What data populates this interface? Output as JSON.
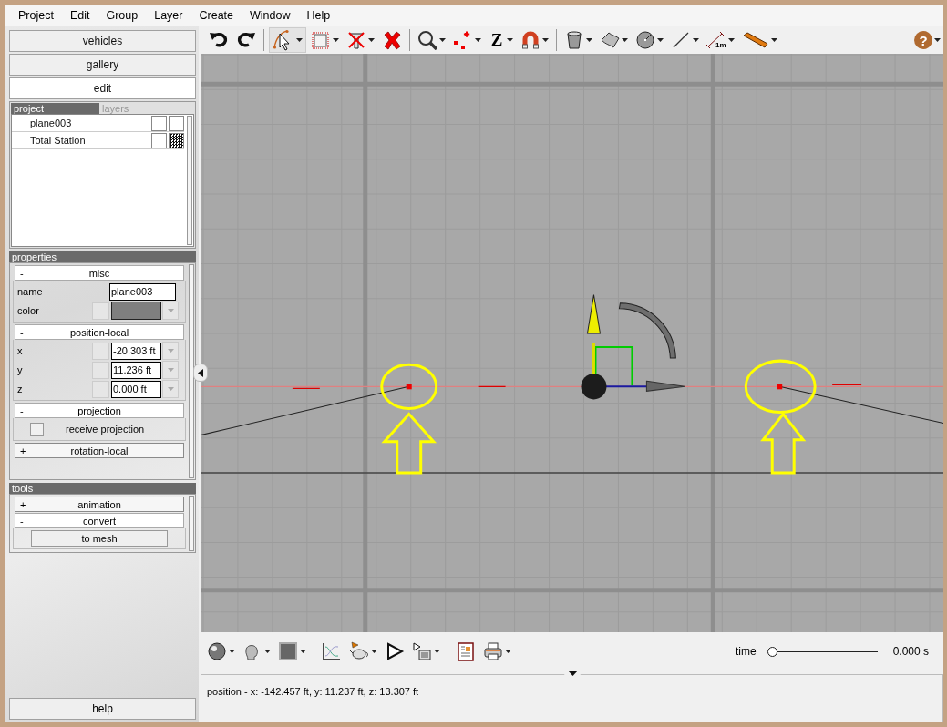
{
  "menu": [
    "Project",
    "Edit",
    "Group",
    "Layer",
    "Create",
    "Window",
    "Help"
  ],
  "side_tabs": [
    {
      "label": "vehicles",
      "selected": false
    },
    {
      "label": "gallery",
      "selected": false
    },
    {
      "label": "edit",
      "selected": true
    }
  ],
  "tree_tabs": [
    {
      "label": "project",
      "selected": true
    },
    {
      "label": "layers",
      "selected": false
    }
  ],
  "objects": [
    {
      "name": "plane003",
      "flags": [
        false,
        false
      ]
    },
    {
      "name": "Total Station",
      "flags": [
        false,
        true
      ]
    }
  ],
  "properties": {
    "title": "properties",
    "sections": [
      {
        "toggle": "-",
        "title": "misc",
        "expanded": true,
        "rows": [
          {
            "kind": "text",
            "label": "name",
            "value": "plane003"
          },
          {
            "kind": "color",
            "label": "color",
            "color": "#7f7f7f"
          }
        ]
      },
      {
        "toggle": "-",
        "title": "position-local",
        "expanded": true,
        "rows": [
          {
            "kind": "number",
            "label": "x",
            "value": "-20.303 ft"
          },
          {
            "kind": "number",
            "label": "y",
            "value": "11.236 ft"
          },
          {
            "kind": "number",
            "label": "z",
            "value": "0.000 ft"
          }
        ]
      },
      {
        "toggle": "-",
        "title": "projection",
        "expanded": true,
        "rows": [
          {
            "kind": "checkbox",
            "label": "receive projection",
            "checked": false
          }
        ]
      },
      {
        "toggle": "+",
        "title": "rotation-local",
        "expanded": false
      }
    ]
  },
  "tools": {
    "title": "tools",
    "sections": [
      {
        "toggle": "+",
        "title": "animation",
        "expanded": false
      },
      {
        "toggle": "-",
        "title": "convert",
        "expanded": true,
        "buttons": [
          "to mesh"
        ]
      }
    ]
  },
  "help_button": "help",
  "toolbar": {
    "select_selected": true,
    "z_label": "Z",
    "measure_label": "1m",
    "help_label": "?"
  },
  "timeline": {
    "label": "time",
    "level": 0,
    "reading": "0.000 s"
  },
  "status": "position - x: -142.457 ft, y: 11.237 ft, z: 13.307 ft"
}
